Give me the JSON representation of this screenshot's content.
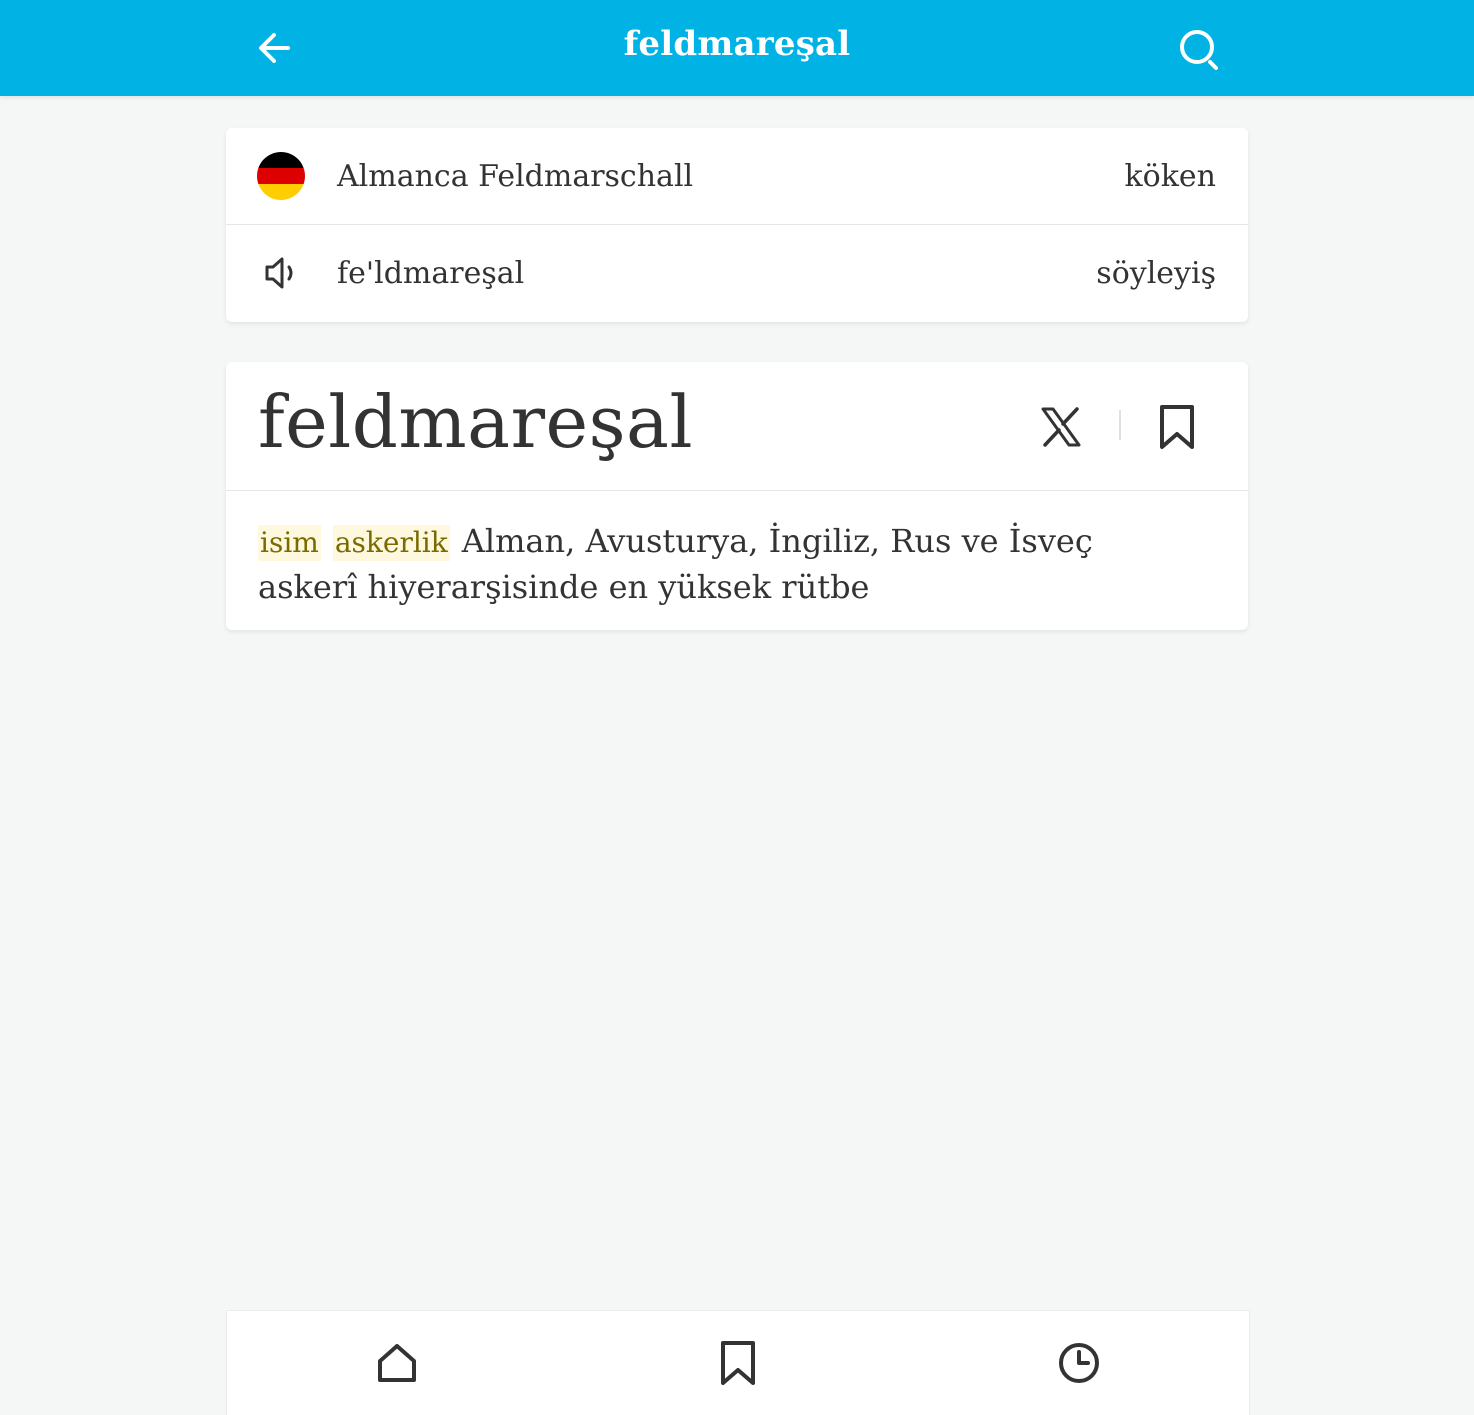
{
  "header": {
    "title": "feldmareşal",
    "back_icon": "arrow-left-icon",
    "search_icon": "search-icon",
    "background": "#00b3e4"
  },
  "info": {
    "origin": {
      "icon": "germany-flag-icon",
      "value": "Almanca Feldmarschall",
      "label": "köken"
    },
    "pronunciation": {
      "icon": "speaker-icon",
      "value": "fe'ldmareşal",
      "label": "söyleyiş"
    }
  },
  "entry": {
    "word": "feldmareşal",
    "share_icon": "x-logo-icon",
    "bookmark_icon": "bookmark-icon",
    "meaning": {
      "tags": [
        "isim",
        "askerlik"
      ],
      "text": "Alman, Avusturya, İngiliz, Rus ve İsveç askerî hiyerarşisinde en yüksek rütbe"
    }
  },
  "bottom_nav": {
    "items": [
      {
        "icon": "home-icon"
      },
      {
        "icon": "bookmark-icon"
      },
      {
        "icon": "history-clock-icon"
      }
    ]
  }
}
